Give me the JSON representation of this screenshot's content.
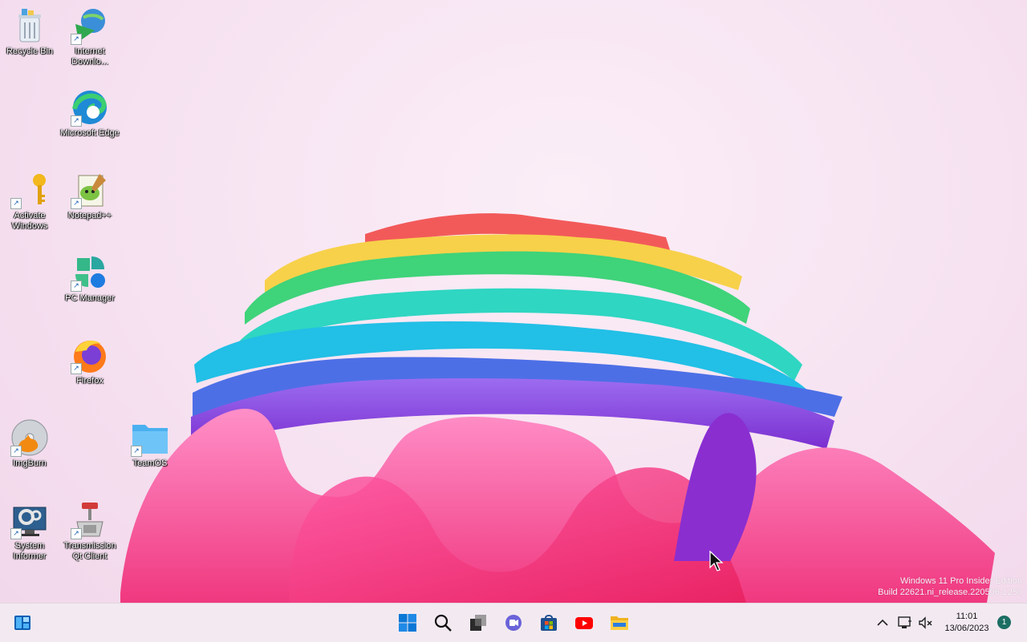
{
  "desktop": {
    "icons": [
      {
        "name": "recycle-bin",
        "label": "Recycle Bin",
        "shortcut": false
      },
      {
        "name": "internet-download-manager",
        "label": "Internet Downlo...",
        "shortcut": true
      },
      {
        "name": "microsoft-edge",
        "label": "Microsoft Edge",
        "shortcut": true
      },
      {
        "name": "activate-windows",
        "label": "Activate Windows",
        "shortcut": true
      },
      {
        "name": "notepad-plus-plus",
        "label": "Notepad++",
        "shortcut": true
      },
      {
        "name": "pc-manager",
        "label": "PC Manager",
        "shortcut": true
      },
      {
        "name": "firefox",
        "label": "Firefox",
        "shortcut": true
      },
      {
        "name": "imgburn",
        "label": "ImgBurn",
        "shortcut": true
      },
      {
        "name": "teamos",
        "label": "TeamOS",
        "shortcut": true
      },
      {
        "name": "system-informer",
        "label": "System Informer",
        "shortcut": true
      },
      {
        "name": "transmission-qt-client",
        "label": "Transmission Qt Client",
        "shortcut": true
      }
    ]
  },
  "watermark": {
    "line1": "Windows 11 Pro Insider Edition",
    "line2": "Build 22621.ni_release.220506-1250"
  },
  "taskbar": {
    "widgets_icon": "widgets-icon",
    "pinned": [
      {
        "name": "start",
        "icon": "windows-logo-icon"
      },
      {
        "name": "search",
        "icon": "search-icon"
      },
      {
        "name": "task-view",
        "icon": "task-view-icon"
      },
      {
        "name": "chat",
        "icon": "teams-chat-icon"
      },
      {
        "name": "store",
        "icon": "microsoft-store-icon"
      },
      {
        "name": "youtube",
        "icon": "youtube-icon"
      },
      {
        "name": "file-explorer",
        "icon": "folder-icon"
      }
    ],
    "tray": {
      "time": "11:01",
      "date": "13/06/2023",
      "notification_count": "1"
    }
  },
  "colors": {
    "taskbar_bg": "#f3eaf1",
    "accent_blue": "#0078d4"
  }
}
